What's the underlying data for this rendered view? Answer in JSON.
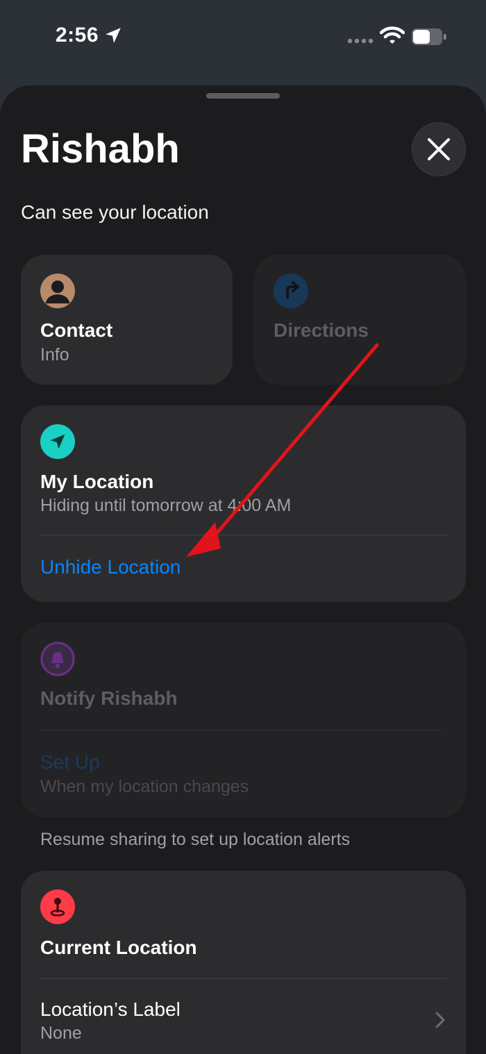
{
  "status_bar": {
    "time": "2:56",
    "icons": [
      "location-arrow-icon",
      "signal-icon",
      "wifi-icon",
      "battery-icon"
    ]
  },
  "header": {
    "title": "Rishabh",
    "subtitle": "Can see your location",
    "close_icon": "close-icon"
  },
  "actions": {
    "contact": {
      "title": "Contact",
      "subtitle": "Info",
      "icon": "person-icon"
    },
    "directions": {
      "title": "Directions",
      "icon": "directions-icon",
      "enabled": false
    }
  },
  "my_location": {
    "title": "My Location",
    "status": "Hiding until tomorrow at 4:00 AM",
    "action": "Unhide Location",
    "icon": "location-arrow-icon"
  },
  "notify": {
    "title": "Notify Rishabh",
    "action": "Set Up",
    "action_sub": "When my location changes",
    "footnote": "Resume sharing to set up location alerts",
    "icon": "bell-icon",
    "enabled": false
  },
  "current_location": {
    "title": "Current Location",
    "label_title": "Location’s Label",
    "label_value": "None",
    "icon": "pin-icon"
  },
  "colors": {
    "accent_blue": "#0a84ff",
    "teal": "#1ad0c4",
    "red": "#ff3b48",
    "annotation_red": "#e3131b",
    "purple": "#9b3fc8"
  }
}
